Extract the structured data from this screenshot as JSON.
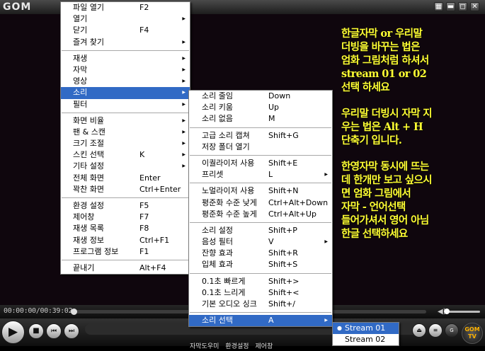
{
  "app": {
    "logo": "GOM",
    "window_buttons": [
      "▦",
      "▬",
      "◻",
      "✕"
    ],
    "time": "00:00:00/00:39:02",
    "mini_toolbar": [
      "자막도우미",
      "환경설정",
      "제어창"
    ],
    "logo_tv": "GOM TV"
  },
  "subtitle_lines": [
    "한글자막 or 우리말",
    "더빙을 바꾸는 법은",
    "엄화 그림처럼 하셔서",
    "stream 01 or 02",
    "선택 하세요",
    "",
    "우리말 더빙시 자막 지",
    "우는 법은 Alt + H",
    "단축기 입니다.",
    "",
    "한영자막 동시에 뜨는",
    "데 한개만 보고 싶으시",
    "면 엄화 그림에서",
    "자막 - 언어선택",
    "들어가셔서 영어 아님",
    "한글 선택하세요"
  ],
  "menu1": [
    {
      "label": "파일 열기",
      "shortcut": "F2",
      "arrow": false
    },
    {
      "label": "열기",
      "shortcut": "",
      "arrow": true
    },
    {
      "label": "닫기",
      "shortcut": "F4",
      "arrow": false
    },
    {
      "label": "즐겨 찾기",
      "shortcut": "",
      "arrow": true
    },
    {
      "sep": true
    },
    {
      "label": "재생",
      "shortcut": "",
      "arrow": true
    },
    {
      "label": "자막",
      "shortcut": "",
      "arrow": true
    },
    {
      "label": "영상",
      "shortcut": "",
      "arrow": true
    },
    {
      "label": "소리",
      "shortcut": "",
      "arrow": true,
      "selected": true
    },
    {
      "label": "필터",
      "shortcut": "",
      "arrow": true
    },
    {
      "sep": true
    },
    {
      "label": "화면 비율",
      "shortcut": "",
      "arrow": true
    },
    {
      "label": "팬 & 스캔",
      "shortcut": "",
      "arrow": true
    },
    {
      "label": "크기 조절",
      "shortcut": "",
      "arrow": true
    },
    {
      "label": "스킨 선택",
      "shortcut": "K",
      "arrow": true
    },
    {
      "label": "기타 설정",
      "shortcut": "",
      "arrow": true
    },
    {
      "label": "전체 화면",
      "shortcut": "Enter",
      "arrow": false
    },
    {
      "label": "꽉찬 화면",
      "shortcut": "Ctrl+Enter",
      "arrow": false
    },
    {
      "sep": true
    },
    {
      "label": "환경 설정",
      "shortcut": "F5",
      "arrow": false
    },
    {
      "label": "제어창",
      "shortcut": "F7",
      "arrow": false
    },
    {
      "label": "재생 목록",
      "shortcut": "F8",
      "arrow": false
    },
    {
      "label": "재생 정보",
      "shortcut": "Ctrl+F1",
      "arrow": false
    },
    {
      "label": "프로그램 정보",
      "shortcut": "F1",
      "arrow": false
    },
    {
      "sep": true
    },
    {
      "label": "끝내기",
      "shortcut": "Alt+F4",
      "arrow": false
    }
  ],
  "menu2": [
    {
      "label": "소리 줄임",
      "shortcut": "Down",
      "arrow": false
    },
    {
      "label": "소리 키움",
      "shortcut": "Up",
      "arrow": false
    },
    {
      "label": "소리 없음",
      "shortcut": "M",
      "arrow": false
    },
    {
      "sep": true
    },
    {
      "label": "고급 소리 캡쳐",
      "shortcut": "Shift+G",
      "arrow": false
    },
    {
      "label": "저장 폴더 열기",
      "shortcut": "",
      "arrow": false
    },
    {
      "sep": true
    },
    {
      "label": "이퀄라이저 사용",
      "shortcut": "Shift+E",
      "arrow": false
    },
    {
      "label": "프리셋",
      "shortcut": "L",
      "arrow": true
    },
    {
      "sep": true
    },
    {
      "label": "노멀라이저 사용",
      "shortcut": "Shift+N",
      "arrow": false
    },
    {
      "label": "평준화 수준 낮게",
      "shortcut": "Ctrl+Alt+Down",
      "arrow": false
    },
    {
      "label": "평준화 수준 높게",
      "shortcut": "Ctrl+Alt+Up",
      "arrow": false
    },
    {
      "sep": true
    },
    {
      "label": "소리 설정",
      "shortcut": "Shift+P",
      "arrow": false
    },
    {
      "label": "음성 필터",
      "shortcut": "V",
      "arrow": true
    },
    {
      "label": "잔향 효과",
      "shortcut": "Shift+R",
      "arrow": false
    },
    {
      "label": "입체 효과",
      "shortcut": "Shift+S",
      "arrow": false
    },
    {
      "sep": true
    },
    {
      "label": "0.1초 빠르게",
      "shortcut": "Shift+>",
      "arrow": false
    },
    {
      "label": "0.1초 느리게",
      "shortcut": "Shift+<",
      "arrow": false
    },
    {
      "label": "기본 오디오 싱크",
      "shortcut": "Shift+/",
      "arrow": false
    },
    {
      "sep": true
    },
    {
      "label": "소리 선택",
      "shortcut": "A",
      "arrow": true,
      "selected": true
    }
  ],
  "menu3": [
    {
      "label": "Stream 01",
      "selected": true,
      "checked": true
    },
    {
      "label": "Stream 02",
      "selected": false,
      "checked": false
    }
  ]
}
